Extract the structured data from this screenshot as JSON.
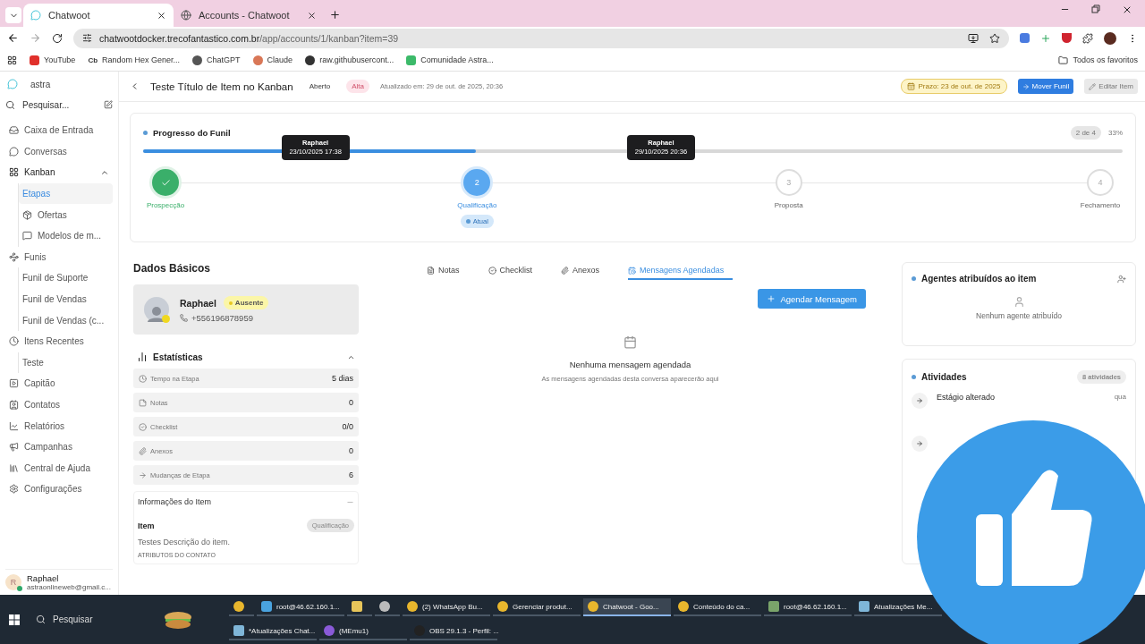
{
  "browser": {
    "tabs": [
      {
        "title": "Chatwoot",
        "selected": true
      },
      {
        "title": "Accounts - Chatwoot",
        "selected": false
      }
    ],
    "url_host": "chatwootdocker.trecofantastico.com.br",
    "url_path": "/app/accounts/1/kanban?item=39",
    "bookmarks": [
      {
        "kind": "youtube",
        "label": "YouTube"
      },
      {
        "kind": "text",
        "icon_text": "Cb",
        "label": "Random Hex Gener..."
      },
      {
        "kind": "openai",
        "label": "ChatGPT"
      },
      {
        "kind": "claude",
        "label": "Claude"
      },
      {
        "kind": "globe",
        "label": "raw.githubusercont..."
      },
      {
        "kind": "whatsapp",
        "label": "Comunidade Astra..."
      }
    ],
    "all_bookmarks": "Todos os favoritos"
  },
  "sidebar": {
    "account": "astra",
    "search_placeholder": "Pesquisar...",
    "items": [
      {
        "label": "Caixa de Entrada",
        "selected": false
      },
      {
        "label": "Conversas",
        "selected": false
      },
      {
        "label": "Kanban",
        "selected": false,
        "expanded": true,
        "children": [
          {
            "label": "Etapas",
            "selected": true
          },
          {
            "label": "Ofertas",
            "selected": false
          },
          {
            "label": "Modelos de m...",
            "selected": false
          }
        ]
      },
      {
        "label": "Funis",
        "selected": false,
        "children": [
          {
            "label": "Funil de Suporte",
            "selected": false
          },
          {
            "label": "Funil de Vendas",
            "selected": false
          },
          {
            "label": "Funil de Vendas (c...",
            "selected": false
          }
        ]
      },
      {
        "label": "Itens Recentes",
        "selected": false,
        "children": [
          {
            "label": "Teste",
            "selected": false
          }
        ]
      },
      {
        "label": "Capitão",
        "selected": false
      },
      {
        "label": "Contatos",
        "selected": false
      },
      {
        "label": "Relatórios",
        "selected": false
      },
      {
        "label": "Campanhas",
        "selected": false
      },
      {
        "label": "Central de Ajuda",
        "selected": false
      },
      {
        "label": "Configurações",
        "selected": false
      }
    ],
    "user": {
      "initial": "R",
      "name": "Raphael",
      "email": "astraonlineweb@gmail.c..."
    }
  },
  "header": {
    "title": "Teste Título de Item no Kanban",
    "status": "Aberto",
    "priority": "Alta",
    "updated": "Atualizado em: 29 de out. de 2025, 20:36",
    "deadline": "Prazo: 23 de out. de 2025",
    "move_button": "Mover Funil",
    "edit_button": "Editar Item"
  },
  "progress": {
    "title": "Progresso do Funil",
    "count": "2 de 4",
    "percent": "33%",
    "level": 0.34,
    "current_label": "Atual",
    "tooltips": [
      {
        "name": "Raphael",
        "time": "23/10/2025 17:38"
      },
      {
        "name": "Raphael",
        "time": "29/10/2025 20:36"
      }
    ],
    "steps": [
      {
        "label": "Prospecção",
        "done": true,
        "current": false
      },
      {
        "number": "2",
        "label": "Qualificação",
        "done": false,
        "current": true
      },
      {
        "number": "3",
        "label": "Proposta",
        "done": false,
        "current": false
      },
      {
        "number": "4",
        "label": "Fechamento",
        "done": false,
        "current": false
      }
    ]
  },
  "basic": {
    "title": "Dados Básicos",
    "contact": {
      "name": "Raphael",
      "presence": "Ausente",
      "phone": "+556196878959"
    },
    "stats_title": "Estatísticas",
    "stats_expanded": true,
    "stats": [
      {
        "label": "Tempo na Etapa",
        "value": "5 dias"
      },
      {
        "label": "Notas",
        "value": "0"
      },
      {
        "label": "Checklist",
        "value": "0/0"
      },
      {
        "label": "Anexos",
        "value": "0"
      },
      {
        "label": "Mudanças de Etapa",
        "value": "6"
      }
    ],
    "info_title": "Informações do Item",
    "item_label": "Item",
    "item_stage": "Qualificação",
    "description": "Testes Descrição do item.",
    "attributes_title": "ATRIBUTOS DO CONTATO"
  },
  "detail_tabs": [
    {
      "label": "Notas",
      "selected": false
    },
    {
      "label": "Checklist",
      "selected": false
    },
    {
      "label": "Anexos",
      "selected": false
    },
    {
      "label": "Mensagens Agendadas",
      "selected": true
    }
  ],
  "schedule": {
    "button": "Agendar Mensagem",
    "empty_title": "Nenhuma mensagem agendada",
    "empty_text": "As mensagens agendadas desta conversa aparecerão aqui"
  },
  "agents": {
    "title": "Agentes atribuídos ao item",
    "empty": "Nenhum agente atribuído"
  },
  "activities": {
    "title": "Atividades",
    "count": "8 atividades",
    "items": [
      {
        "kind": "stage_change",
        "title": "Estágio alterado",
        "time": "qua"
      },
      {
        "kind": "stage_change"
      }
    ]
  },
  "taskbar": {
    "search": "Pesquisar",
    "apps": [
      [
        {
          "kind": "chrome",
          "selected": false
        },
        {
          "kind": "terminal",
          "label": "root@46.62.160.1...",
          "selected": false
        },
        {
          "kind": "folder",
          "selected": false
        },
        {
          "kind": "tool",
          "selected": false
        },
        {
          "kind": "chrome",
          "label": "(2) WhatsApp Bu...",
          "selected": false
        },
        {
          "kind": "chrome",
          "label": "Gerenciar produt...",
          "selected": false
        },
        {
          "kind": "chrome",
          "label": "Chatwoot - Goo...",
          "selected": true
        },
        {
          "kind": "chrome",
          "label": "Conteúdo do ca...",
          "selected": false
        },
        {
          "kind": "image",
          "label": "root@46.62.160.1...",
          "selected": false
        },
        {
          "kind": "notepad",
          "label": "Atualizações Me...",
          "selected": false
        }
      ],
      [
        {
          "kind": "notepad",
          "label": "*Atualizações Chat...",
          "selected": false
        },
        {
          "kind": "memu",
          "label": "(MEmu1)",
          "selected": false
        },
        {
          "kind": "obs",
          "label": "OBS 29.1.3 - Perfil: ...",
          "selected": false
        }
      ]
    ]
  }
}
